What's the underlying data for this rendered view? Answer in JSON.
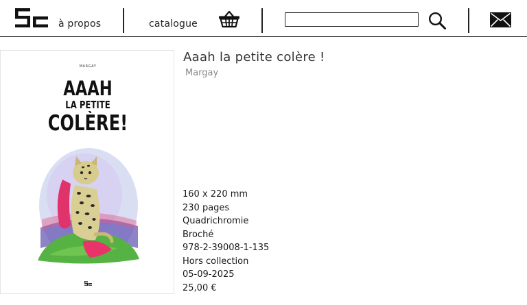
{
  "header": {
    "logo_text": "5c",
    "nav": {
      "about": "à propos",
      "catalogue": "catalogue"
    },
    "basket_icon": "basket-icon",
    "search": {
      "value": "",
      "placeholder": ""
    },
    "search_icon": "magnifier-icon",
    "mail_icon": "envelope-icon"
  },
  "book": {
    "title": "Aaah la petite colère !",
    "author": "Margay",
    "cover": {
      "author_line": "MARGAY",
      "title_line1": "AAAH",
      "title_line2": "LA PETITE",
      "title_line3": "COLÈRE!",
      "publisher_mark": "5c"
    },
    "specs": [
      "160 x 220 mm",
      "230 pages",
      "Quadrichromie",
      "Broché",
      "978-2-39008-1-135",
      "Hors collection",
      "05-09-2025",
      "25,00 €"
    ]
  }
}
